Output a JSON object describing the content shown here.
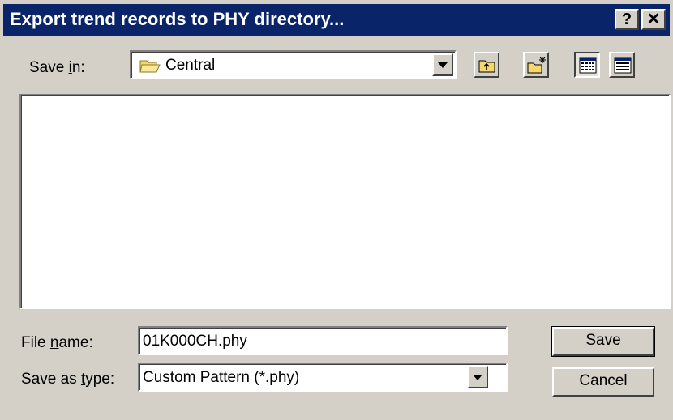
{
  "window": {
    "title": "Export trend records to PHY directory...",
    "help_label": "?",
    "close_label": "✕"
  },
  "save_in": {
    "label_prefix": "Save ",
    "label_accel": "i",
    "label_suffix": "n:",
    "value": "Central",
    "icon": "folder-icon"
  },
  "toolbar": {
    "icons": [
      "up-one-level-icon",
      "new-folder-icon",
      "list-view-icon",
      "details-view-icon"
    ]
  },
  "file_name": {
    "label_prefix": "File ",
    "label_accel": "n",
    "label_suffix": "ame:",
    "value": "01K000CH.phy"
  },
  "save_as_type": {
    "label_prefix": "Save as ",
    "label_accel": "t",
    "label_suffix": "ype:",
    "value": "Custom Pattern (*.phy)"
  },
  "buttons": {
    "save_accel": "S",
    "save_rest": "ave",
    "cancel": "Cancel"
  },
  "colors": {
    "titlebar": "#0a246a",
    "face": "#d4d0c8",
    "folder": "#f5d76e"
  }
}
